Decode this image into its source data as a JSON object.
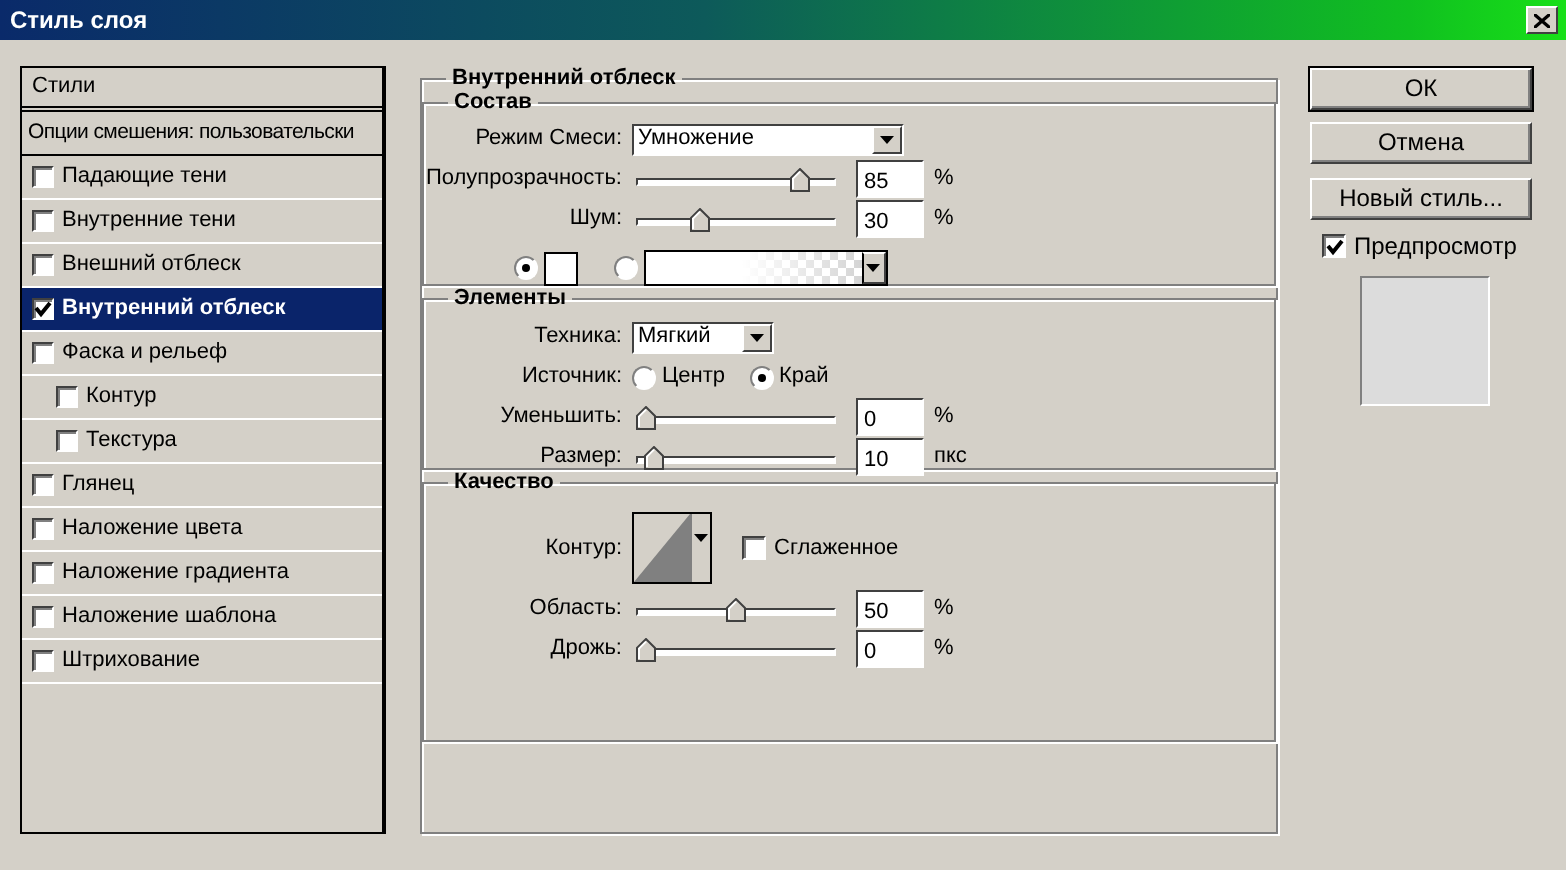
{
  "window": {
    "title": "Стиль слоя"
  },
  "sidebar": {
    "items": [
      {
        "kind": "header",
        "label": "Стили",
        "selected": false
      },
      {
        "kind": "option",
        "label": "Опции смешения: пользовательски",
        "selected": false
      },
      {
        "kind": "check",
        "label": "Падающие тени",
        "checked": false,
        "selected": false
      },
      {
        "kind": "check",
        "label": "Внутренние тени",
        "checked": false,
        "selected": false
      },
      {
        "kind": "check",
        "label": "Внешний отблеск",
        "checked": false,
        "selected": false
      },
      {
        "kind": "check",
        "label": "Внутренний отблеск",
        "checked": true,
        "selected": true
      },
      {
        "kind": "check",
        "label": "Фаска и рельеф",
        "checked": false,
        "selected": false,
        "children": [
          {
            "kind": "check",
            "label": "Контур",
            "checked": false,
            "selected": false
          },
          {
            "kind": "check",
            "label": "Текстура",
            "checked": false,
            "selected": false
          }
        ]
      },
      {
        "kind": "check",
        "label": "Глянец",
        "checked": false,
        "selected": false
      },
      {
        "kind": "check",
        "label": "Наложение цвета",
        "checked": false,
        "selected": false
      },
      {
        "kind": "check",
        "label": "Наложение градиента",
        "checked": false,
        "selected": false
      },
      {
        "kind": "check",
        "label": "Наложение шаблона",
        "checked": false,
        "selected": false
      },
      {
        "kind": "check",
        "label": "Штрихование",
        "checked": false,
        "selected": false
      }
    ]
  },
  "panel": {
    "title": "Внутренний отблеск",
    "groups": [
      {
        "title": "Состав",
        "rows": [
          {
            "kind": "dropdown",
            "label": "Режим Смеси:",
            "value": "Умножение"
          },
          {
            "kind": "slider",
            "label": "Полупрозрачность:",
            "level": 0.85,
            "value": "85",
            "unit": "%"
          },
          {
            "kind": "slider",
            "label": "Шум:",
            "level": 0.3,
            "value": "30",
            "unit": "%"
          },
          {
            "kind": "fill",
            "options": [
              {
                "kind": "color",
                "selected": true
              },
              {
                "kind": "gradient",
                "selected": false
              }
            ]
          }
        ]
      },
      {
        "title": "Элементы",
        "rows": [
          {
            "kind": "dropdown",
            "label": "Техника:",
            "value": "Мягкий"
          },
          {
            "kind": "radios",
            "label": "Источник:",
            "options": [
              {
                "label": "Центр",
                "selected": false
              },
              {
                "label": "Край",
                "selected": true
              }
            ]
          },
          {
            "kind": "slider",
            "label": "Уменьшить:",
            "level": 0,
            "value": "0",
            "unit": "%"
          },
          {
            "kind": "slider",
            "label": "Размер:",
            "level": 0.04,
            "value": "10",
            "unit": "пкс"
          }
        ]
      },
      {
        "title": "Качество",
        "rows": [
          {
            "kind": "contour",
            "label": "Контур:",
            "checkbox": {
              "label": "Сглаженное",
              "checked": false
            }
          },
          {
            "kind": "slider",
            "label": "Область:",
            "level": 0.5,
            "value": "50",
            "unit": "%"
          },
          {
            "kind": "slider",
            "label": "Дрожь:",
            "level": 0,
            "value": "0",
            "unit": "%"
          }
        ]
      }
    ]
  },
  "buttons": [
    {
      "label": "ОК",
      "default": true
    },
    {
      "label": "Отмена",
      "default": false
    },
    {
      "label": "Новый стиль...",
      "default": false
    }
  ],
  "preview": {
    "label": "Предпросмотр",
    "checked": true
  }
}
